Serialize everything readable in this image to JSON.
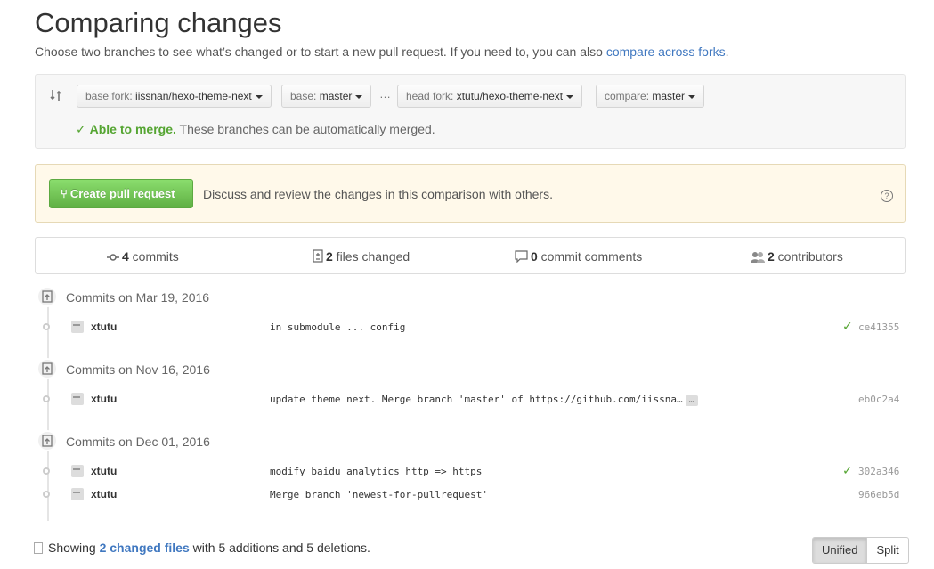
{
  "page": {
    "title": "Comparing changes",
    "lead_text": "Choose two branches to see what’s changed or to start a new pull request. If you need to, you can also ",
    "lead_link": "compare across forks",
    "lead_end": "."
  },
  "range": {
    "base_fork_label": "base fork: ",
    "base_fork_value": "iissnan/hexo-theme-next",
    "base_label": "base: ",
    "base_value": "master",
    "separator": "…",
    "head_fork_label": "head fork: ",
    "head_fork_value": "xtutu/hexo-theme-next",
    "compare_label": "compare: ",
    "compare_value": "master",
    "merge_status": "Able to merge.",
    "merge_message": " These branches can be automatically merged."
  },
  "pull_request": {
    "button_label": "Create pull request",
    "description": "Discuss and review the changes in this comparison with others.",
    "help": "?"
  },
  "stats": {
    "commits_count": "4",
    "commits_label": " commits",
    "files_count": "2",
    "files_label": " files changed",
    "comments_count": "0",
    "comments_label": " commit comments",
    "contributors_count": "2",
    "contributors_label": " contributors"
  },
  "commit_groups": [
    {
      "date": "Commits on Mar 19, 2016",
      "commits": [
        {
          "author": "xtutu",
          "message": "in submodule ... config",
          "sha": "ce41355",
          "verified": true
        }
      ]
    },
    {
      "date": "Commits on Nov 16, 2016",
      "commits": [
        {
          "author": "xtutu",
          "message": "update theme next. Merge branch 'master' of https://github.com/iissna…",
          "more": "…",
          "sha": "eb0c2a4",
          "verified": false
        }
      ]
    },
    {
      "date": "Commits on Dec 01, 2016",
      "commits": [
        {
          "author": "xtutu",
          "message": "modify baidu analytics http => https",
          "sha": "302a346",
          "verified": true
        },
        {
          "author": "xtutu",
          "message": "Merge branch 'newest-for-pullrequest'",
          "sha": "966eb5d",
          "verified": false
        }
      ]
    }
  ],
  "footer": {
    "showing": "Showing ",
    "changed_files": "2 changed files",
    "with": " with ",
    "additions": "5 additions",
    "and": " and ",
    "deletions": "5 deletions",
    "end": "."
  },
  "view_toggle": {
    "unified": "Unified",
    "split": "Split"
  },
  "colors": {
    "link": "#4078c0",
    "success": "#55a532",
    "button_green": "#60b044"
  }
}
